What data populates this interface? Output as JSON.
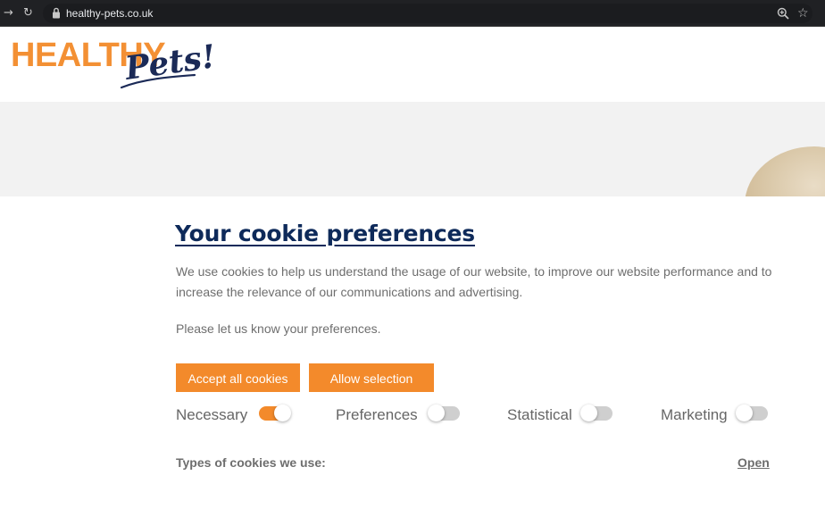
{
  "browser": {
    "url": "healthy-pets.co.uk",
    "icons": [
      "back-arrow-icon",
      "reload-icon",
      "lock-icon",
      "zoom-icon",
      "star-icon"
    ]
  },
  "logo": {
    "primary": "HEALTHY",
    "secondary": "Pets!",
    "colors": {
      "primary": "#f39034",
      "secondary": "#1b2a57"
    }
  },
  "cookie_banner": {
    "title": "Your cookie preferences",
    "description": "We use cookies to help us understand the usage of our website, to improve our website performance and to increase the relevance of our communications and advertising.",
    "prompt": "Please let us know your preferences.",
    "buttons": {
      "accept_all": "Accept all cookies",
      "allow_selection": "Allow selection"
    },
    "options": [
      {
        "label": "Necessary",
        "enabled": true
      },
      {
        "label": "Preferences",
        "enabled": false
      },
      {
        "label": "Statistical",
        "enabled": false
      },
      {
        "label": "Marketing",
        "enabled": false
      }
    ],
    "types_label": "Types of cookies we use:",
    "open_link": "Open"
  },
  "colors": {
    "accent": "#f38a2b",
    "title": "#0e2a5a",
    "body_text": "#6e6e6e",
    "toggle_off": "#cfcfcf"
  }
}
